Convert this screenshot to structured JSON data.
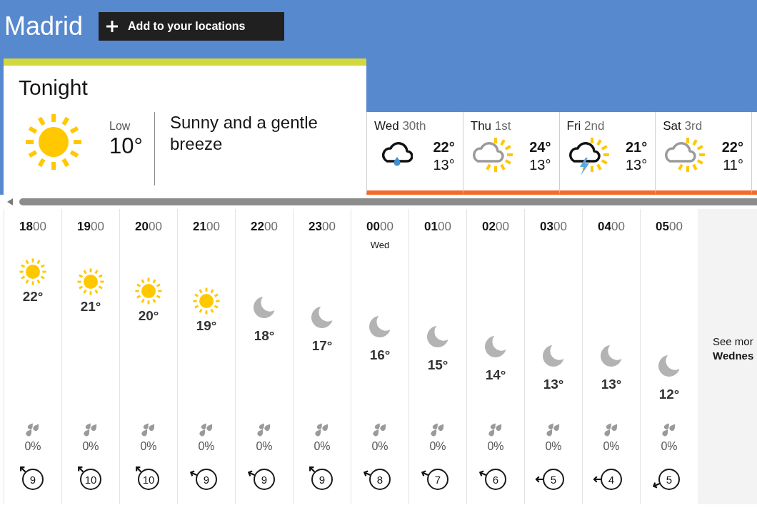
{
  "location": "Madrid",
  "add_button": "Add to your locations",
  "tonight": {
    "title": "Tonight",
    "low_label": "Low",
    "low": "10°",
    "summary": "Sunny and a gentle breeze"
  },
  "days": [
    {
      "day": "Wed",
      "date": "30th",
      "kind": "showers",
      "high": "22°",
      "low": "13°"
    },
    {
      "day": "Thu",
      "date": "1st",
      "kind": "suncloud",
      "high": "24°",
      "low": "13°"
    },
    {
      "day": "Fri",
      "date": "2nd",
      "kind": "thunder",
      "high": "21°",
      "low": "13°"
    },
    {
      "day": "Sat",
      "date": "3rd",
      "kind": "suncloud",
      "high": "22°",
      "low": "11°"
    }
  ],
  "hours": [
    {
      "time": "**18**00",
      "kind": "sunny",
      "temperature": "22°",
      "rain": "0%",
      "wind": {
        "speed": "9",
        "kind": "nw"
      }
    },
    {
      "time": "**19**00",
      "kind": "sunny",
      "temperature": "21°",
      "rain": "0%",
      "wind": {
        "speed": "10",
        "kind": "nw"
      }
    },
    {
      "time": "**20**00",
      "kind": "sunny",
      "temperature": "20°",
      "rain": "0%",
      "wind": {
        "speed": "10",
        "kind": "nw"
      }
    },
    {
      "time": "**21**00",
      "kind": "sunny",
      "temperature": "19°",
      "rain": "0%",
      "wind": {
        "speed": "9",
        "kind": "wnw"
      }
    },
    {
      "time": "**22**00",
      "kind": "clear",
      "temperature": "18°",
      "rain": "0%",
      "wind": {
        "speed": "9",
        "kind": "wnw"
      }
    },
    {
      "time": "**23**00",
      "kind": "clear",
      "temperature": "17°",
      "rain": "0%",
      "wind": {
        "speed": "9",
        "kind": "nw"
      }
    },
    {
      "time": "**00**00",
      "day": "Wed",
      "kind": "clear",
      "temperature": "16°",
      "rain": "0%",
      "wind": {
        "speed": "8",
        "kind": "wnw"
      }
    },
    {
      "time": "**01**00",
      "kind": "clear",
      "temperature": "15°",
      "rain": "0%",
      "wind": {
        "speed": "7",
        "kind": "wnw"
      }
    },
    {
      "time": "**02**00",
      "kind": "clear",
      "temperature": "14°",
      "rain": "0%",
      "wind": {
        "speed": "6",
        "kind": "wnw"
      }
    },
    {
      "time": "**03**00",
      "kind": "clear",
      "temperature": "13°",
      "rain": "0%",
      "wind": {
        "speed": "5",
        "kind": "w"
      }
    },
    {
      "time": "**04**00",
      "kind": "clear",
      "temperature": "13°",
      "rain": "0%",
      "wind": {
        "speed": "4",
        "kind": "w"
      }
    },
    {
      "time": "**05**00",
      "kind": "clear",
      "temperature": "12°",
      "rain": "0%",
      "wind": {
        "speed": "5",
        "kind": "wsw"
      }
    }
  ],
  "see_more": {
    "text": "See mor",
    "day": "Wednes"
  }
}
